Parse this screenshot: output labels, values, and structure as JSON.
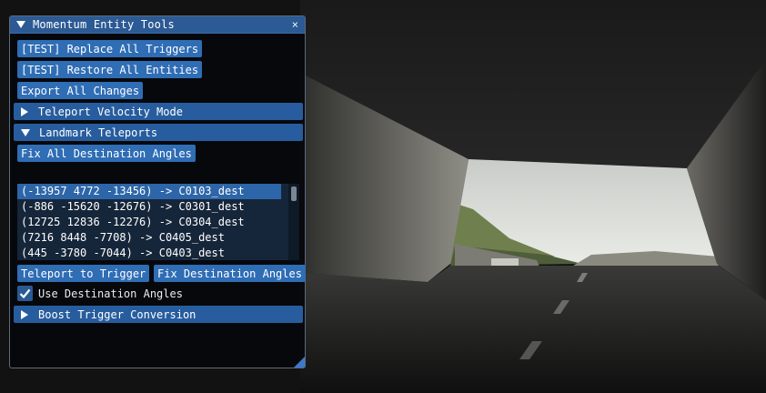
{
  "window": {
    "title": "Momentum Entity Tools",
    "close_glyph": "×"
  },
  "buttons": {
    "replace_triggers": "[TEST] Replace All Triggers",
    "restore_entities": "[TEST] Restore All Entities",
    "export_changes": "Export All Changes",
    "fix_all_angles": "Fix All Destination Angles",
    "teleport_to_trigger": "Teleport to Trigger",
    "fix_destination_angles": "Fix Destination Angles"
  },
  "headers": {
    "teleport_velocity": "Teleport Velocity Mode",
    "landmark_teleports": "Landmark Teleports",
    "boost_trigger": "Boost Trigger Conversion"
  },
  "teleport_list": [
    "(-13957 4772 -13456) -> C0103_dest",
    "(-886 -15620 -12676) -> C0301_dest",
    "(12725 12836 -12276) -> C0304_dest",
    "(7216 8448 -7708) -> C0405_dest",
    "(445 -3780 -7044) -> C0403_dest"
  ],
  "selected_index": 0,
  "checkbox": {
    "label": "Use Destination Angles",
    "checked": true
  },
  "colors": {
    "button": "#2f6db5",
    "header": "#275d9e",
    "titlebar": "#2b5a94",
    "selection": "#2d66a8"
  }
}
